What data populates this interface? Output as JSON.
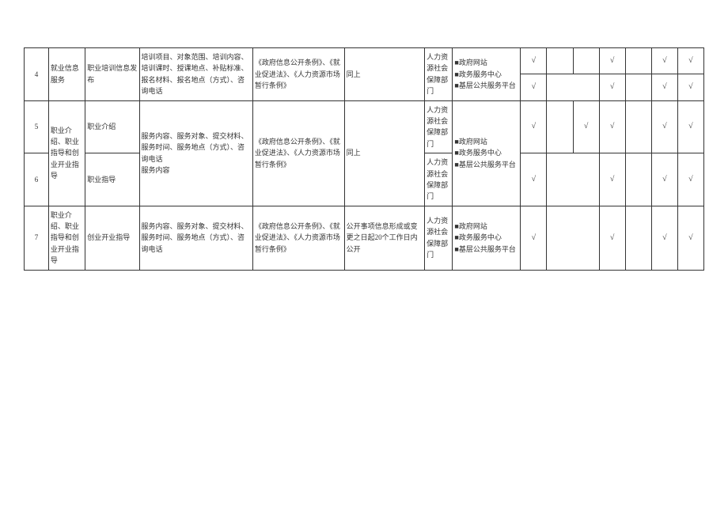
{
  "checkmark": "√",
  "square": "■",
  "rows": {
    "r3_checks": [
      "√",
      "",
      "",
      "√",
      "",
      "√",
      "√"
    ],
    "r4": {
      "num": "4",
      "cat": "就业信息服务",
      "sub": "职业培训信息发布",
      "content": "培训项目、对象范围、培训内容、培训课时、授课地点、补贴标准、报名材料、报名地点（方式）、咨询电话",
      "basis": "《政府信息公开条例》、《就业促进法》、《人力资源市场暂行条例》",
      "time": "同上",
      "dept": "人力资源社会保障部门",
      "channels": [
        "政府网站",
        "政务服务中心",
        "基层公共服务平台"
      ],
      "checks": [
        "√",
        "",
        "√",
        "",
        "√",
        "√"
      ]
    },
    "r5": {
      "num": "5",
      "cat": "职业介绍、职业指导和创业开业指导",
      "sub": "职业介绍",
      "content": "服务内容、服务对象、提交材料、服务时间、服务地点（方式）、咨询电话\n服务内容",
      "basis": "《政府信息公开条例》、《就业促进法》、《人力资源市场暂行条例》",
      "time": "同上",
      "dept": "人力资源社会保障部门",
      "channels": [
        "政府网站",
        "政务服务中心",
        "基层公共服务平台"
      ],
      "checks": [
        "√",
        "",
        "√",
        "√",
        "",
        "√",
        "√"
      ]
    },
    "r6": {
      "num": "6",
      "sub": "职业指导",
      "dept": "人力资源社会保障部门",
      "checks": [
        "√",
        "",
        "√",
        "",
        "√",
        "√"
      ]
    },
    "r7": {
      "num": "7",
      "cat": "职业介绍、职业指导和创业开业指导",
      "sub": "创业开业指导",
      "content": "服务内容、服务对象、提交材料、服务时间、服务地点（方式）、咨询电话",
      "basis": "《政府信息公开条例》、《就业促进法》、《人力资源市场暂行条例》",
      "time": "公开事项信息形成或变更之日起20个工作日内公开",
      "dept": "人力资源社会保障部门",
      "channels": [
        "政府网站",
        "政务服务中心",
        "基层公共服务平台"
      ],
      "checks": [
        "√",
        "",
        "√",
        "",
        "√",
        "√"
      ]
    }
  }
}
